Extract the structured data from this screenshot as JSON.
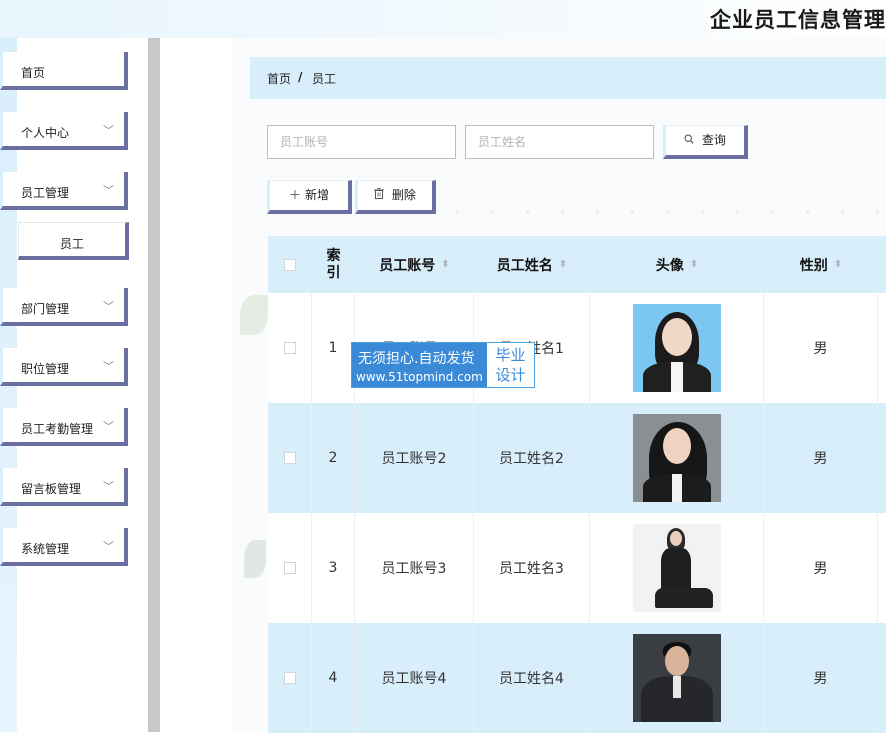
{
  "app": {
    "title": "企业员工信息管理"
  },
  "sidebar": {
    "items": [
      {
        "label": "首页",
        "chevron": false
      },
      {
        "label": "个人中心",
        "chevron": true
      },
      {
        "label": "员工管理",
        "chevron": true
      },
      {
        "label": "员工",
        "sub": true
      },
      {
        "label": "部门管理",
        "chevron": true
      },
      {
        "label": "职位管理",
        "chevron": true
      },
      {
        "label": "员工考勤管理",
        "chevron": true
      },
      {
        "label": "留言板管理",
        "chevron": true
      },
      {
        "label": "系统管理",
        "chevron": true
      }
    ]
  },
  "breadcrumb": {
    "home": "首页",
    "separator": "/",
    "current": "员工"
  },
  "search": {
    "account_placeholder": "员工账号",
    "name_placeholder": "员工姓名",
    "query_label": "查询"
  },
  "toolbar": {
    "add_label": "新增",
    "delete_label": "删除"
  },
  "table": {
    "headers": {
      "index": "索\n引",
      "account": "员工账号",
      "name": "员工姓名",
      "avatar": "头像",
      "gender": "性别"
    },
    "rows": [
      {
        "index": "1",
        "account": "员工账号1",
        "name": "员工姓名1",
        "gender": "男"
      },
      {
        "index": "2",
        "account": "员工账号2",
        "name": "员工姓名2",
        "gender": "男"
      },
      {
        "index": "3",
        "account": "员工账号3",
        "name": "员工姓名3",
        "gender": "男"
      },
      {
        "index": "4",
        "account": "员工账号4",
        "name": "员工姓名4",
        "gender": "男"
      }
    ]
  },
  "watermark": {
    "line1": "无须担心.自动发货",
    "line2": "www.51topmind.com",
    "right": "毕业设计"
  },
  "icons": {
    "search": "search-icon",
    "add": "plus-icon",
    "delete": "trash-icon",
    "chevron": "chevron-down-icon",
    "sort": "sort-icon"
  },
  "colors": {
    "accent": "#d9eefb",
    "border_accent": "#6a6ea0",
    "watermark_blue": "#3a8ad8"
  }
}
